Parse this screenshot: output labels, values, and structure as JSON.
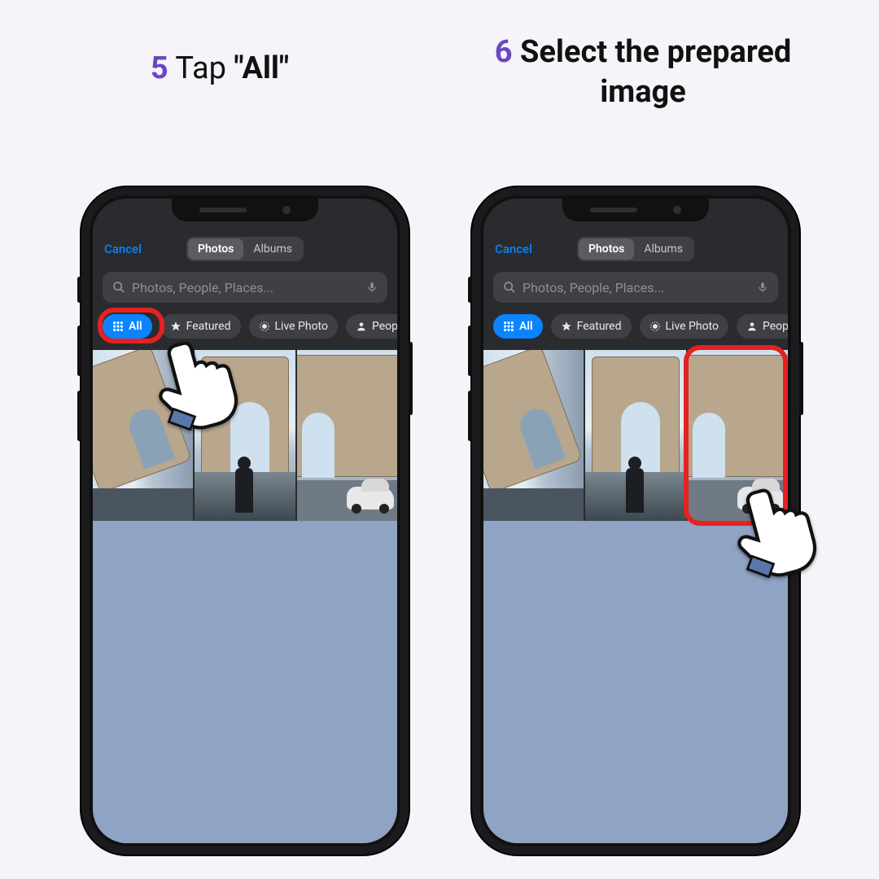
{
  "steps": {
    "s5": {
      "num": "5",
      "pre": " Tap ",
      "quote_open": "\"",
      "bold": "All",
      "quote_close": "\""
    },
    "s6": {
      "num": "6",
      "text": " Select the prepared image"
    }
  },
  "picker": {
    "cancel": "Cancel",
    "segments": {
      "photos": "Photos",
      "albums": "Albums"
    },
    "search_placeholder": "Photos, People, Places...",
    "chips": {
      "all": "All",
      "featured": "Featured",
      "live": "Live Photo",
      "people": "People"
    }
  },
  "colors": {
    "accent": "#0a84ff",
    "highlight": "#e52121",
    "step_num": "#6b46c1"
  }
}
